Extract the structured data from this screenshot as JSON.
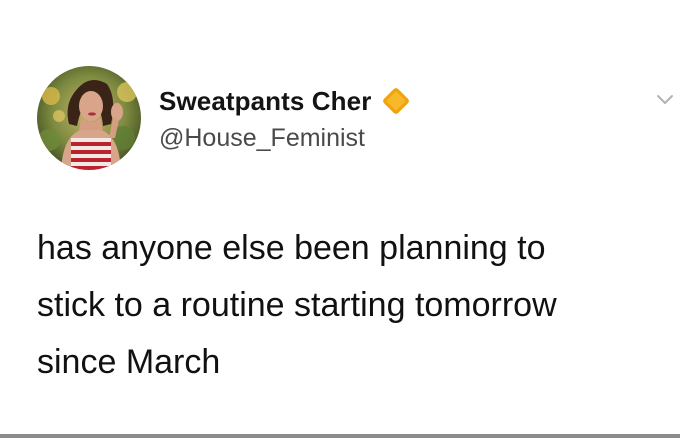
{
  "tweet": {
    "author": {
      "display_name": "Sweatpants Cher",
      "handle": "@House_Feminist",
      "avatar_icon": "profile-photo",
      "verified_icon": "verified-badge-icon"
    },
    "menu_icon": "chevron-down-icon",
    "text_lines": [
      "has anyone else been planning to",
      "stick to a routine starting tomorrow",
      "since March"
    ]
  },
  "colors": {
    "background": "#ffffff",
    "text": "#111111",
    "handle": "#4a4a4a",
    "verified_badge": "#f0a30a"
  }
}
